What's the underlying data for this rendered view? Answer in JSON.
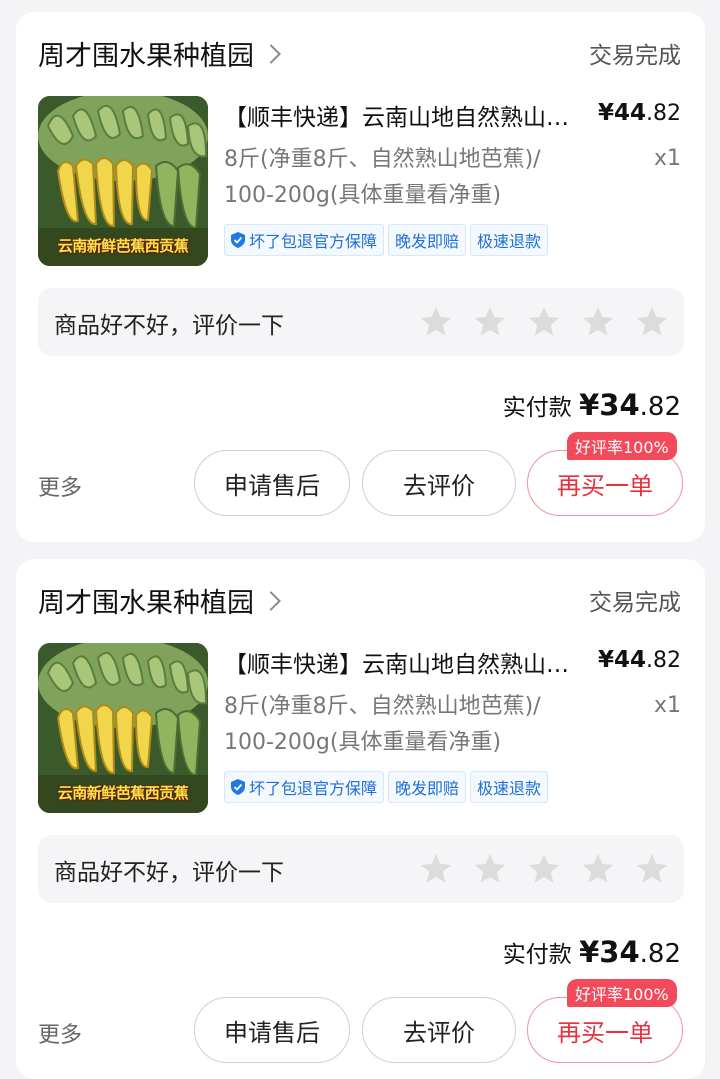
{
  "orders": [
    {
      "shop_name": "周才围水果种植园",
      "status": "交易完成",
      "product_image_caption": "云南新鲜芭蕉西贡蕉",
      "title": "【顺丰快递】云南山地自然熟山地芭蕉",
      "price_symbol": "¥",
      "price_int": "44",
      "price_cents": ".82",
      "spec_line1": "8斤(净重8斤、自然熟山地芭蕉)/",
      "spec_line2": "100-200g(具体重量看净重)",
      "quantity": "x1",
      "tags": [
        "坏了包退官方保障",
        "晚发即赔",
        "极速退款"
      ],
      "review_prompt": "商品好不好，评价一下",
      "star_count": 5,
      "paid_label": "实付款",
      "paid_symbol": "¥",
      "paid_int": "34",
      "paid_cents": ".82",
      "more_label": "更多",
      "btn_after_sale": "申请售后",
      "btn_review": "去评价",
      "btn_rebuy": "再买一单",
      "badge": "好评率100%"
    },
    {
      "shop_name": "周才围水果种植园",
      "status": "交易完成",
      "product_image_caption": "云南新鲜芭蕉西贡蕉",
      "title": "【顺丰快递】云南山地自然熟山地芭蕉",
      "price_symbol": "¥",
      "price_int": "44",
      "price_cents": ".82",
      "spec_line1": "8斤(净重8斤、自然熟山地芭蕉)/",
      "spec_line2": "100-200g(具体重量看净重)",
      "quantity": "x1",
      "tags": [
        "坏了包退官方保障",
        "晚发即赔",
        "极速退款"
      ],
      "review_prompt": "商品好不好，评价一下",
      "star_count": 5,
      "paid_label": "实付款",
      "paid_symbol": "¥",
      "paid_int": "34",
      "paid_cents": ".82",
      "more_label": "更多",
      "btn_after_sale": "申请售后",
      "btn_review": "去评价",
      "btn_rebuy": "再买一单",
      "badge": "好评率100%"
    }
  ],
  "colors": {
    "page_bg": "#f4f4f6",
    "accent_red": "#e8313f",
    "badge_red": "#f24a5a",
    "tag_blue": "#1f6fd6",
    "star_gray": "#dcdcdc"
  },
  "icons": {
    "shop_chevron": "chevron-right-icon",
    "tag_shield": "shield-check-icon",
    "rating_star": "star-icon"
  }
}
